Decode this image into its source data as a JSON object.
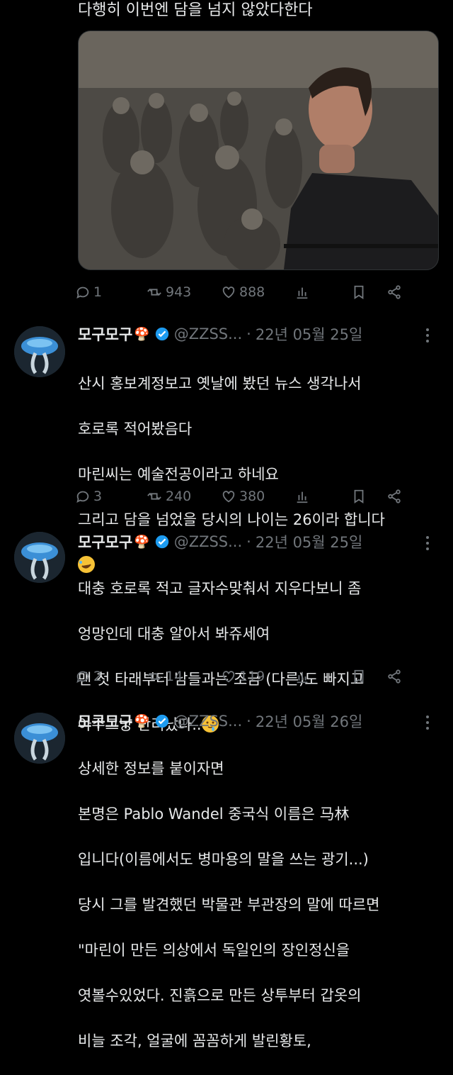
{
  "top_tweet": {
    "text_tail": "다행히 이번엔 담을 넘지 않았다한다",
    "stats": {
      "replies": "1",
      "retweets": "943",
      "likes": "888"
    }
  },
  "tweets": [
    {
      "name": "모구모구",
      "handle": "@ZZSS...",
      "date": "22년 05월 25일",
      "lines": [
        "산시 홍보계정보고 옛날에 봤던 뉴스 생각나서",
        "호로록 적어봤음다",
        "마린씨는 예술전공이라고 하네요",
        "그리고 담을 넘었을 당시의 나이는 26이라 합니다"
      ],
      "emoji": "rolling-on-floor-laughing-emoji",
      "stats": {
        "replies": "3",
        "retweets": "240",
        "likes": "380"
      }
    },
    {
      "name": "모구모구",
      "handle": "@ZZSS...",
      "date": "22년 05월 25일",
      "lines": [
        "대충 호로록 적고 글자수맞춰서 지우다보니 좀",
        "엉망인데 대충 알아서 봐쥬세여",
        "맨 첫 타래부터 남들과는 조금 (다른)도 빠지고",
        "아주그냥 난리났다.."
      ],
      "emoji": "drooling-face-emoji",
      "stats": {
        "replies": "2",
        "retweets": "14",
        "likes": "119"
      }
    },
    {
      "name": "모구모구",
      "handle": "@ZZSS...",
      "date": "22년 05월 26일",
      "lines": [
        "상세한 정보를 붙이자면",
        "본명은 Pablo Wandel 중국식 이름은 马林",
        "입니다(이름에서도 병마용의 말을 쓰는 광기...)",
        "당시 그를 발견했던 박물관 부관장의 말에 따르면",
        "\"마린이 만든 의상에서 독일인의 장인정신을",
        "엿볼수있었다. 진흙으로 만든 상투부터 갑옷의",
        "비늘 조각, 얼굴에 꼼꼼하게 발린황토,"
      ]
    }
  ],
  "colors": {
    "background": "#000000",
    "text": "#e7e9ea",
    "muted": "#71767b",
    "verified": "#1d9bf0"
  }
}
